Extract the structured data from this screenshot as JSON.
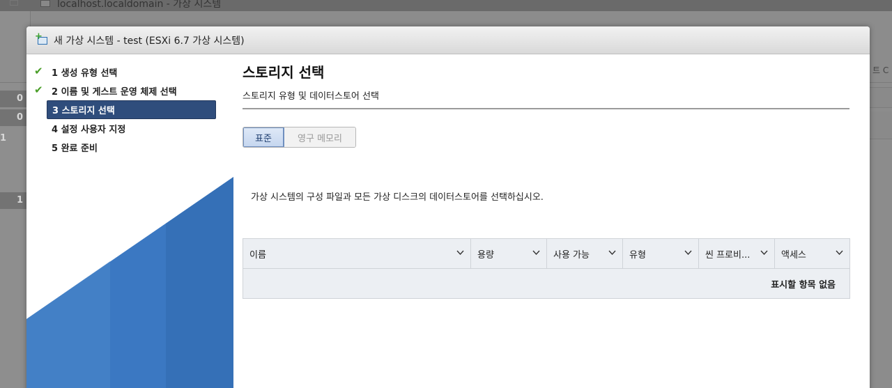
{
  "background": {
    "window_title": "localhost.localdomain - 가상 시스템",
    "row_numbers": [
      "0",
      "0",
      "1",
      "1"
    ],
    "right_edge_text": "트 C"
  },
  "modal": {
    "title": "새 가상 시스템 - test (ESXi 6.7 가상 시스템)",
    "icon": "new-vm-icon"
  },
  "steps": [
    {
      "label": "1 생성 유형 선택",
      "state": "completed"
    },
    {
      "label": "2 이름 및 게스트 운영 체제 선택",
      "state": "completed"
    },
    {
      "label": "3 스토리지 선택",
      "state": "active"
    },
    {
      "label": "4 설정 사용자 지정",
      "state": "pending"
    },
    {
      "label": "5 완료 준비",
      "state": "pending"
    }
  ],
  "content": {
    "title": "스토리지 선택",
    "subtitle": "스토리지 유형 및 데이터스토어 선택",
    "tabs": [
      {
        "label": "표준",
        "selected": true
      },
      {
        "label": "영구 메모리",
        "selected": false
      }
    ],
    "instruction": "가상 시스템의 구성 파일과 모든 가상 디스크의 데이터스토어를 선택하십시오.",
    "table": {
      "columns": [
        "이름",
        "용량",
        "사용 가능",
        "유형",
        "씬 프로비...",
        "액세스"
      ],
      "empty_message": "표시할 항목 없음"
    }
  },
  "colors": {
    "active_step_bg": "#2f4d7c",
    "check_green": "#4a9e28",
    "deco_blue": "#3b78c2"
  }
}
